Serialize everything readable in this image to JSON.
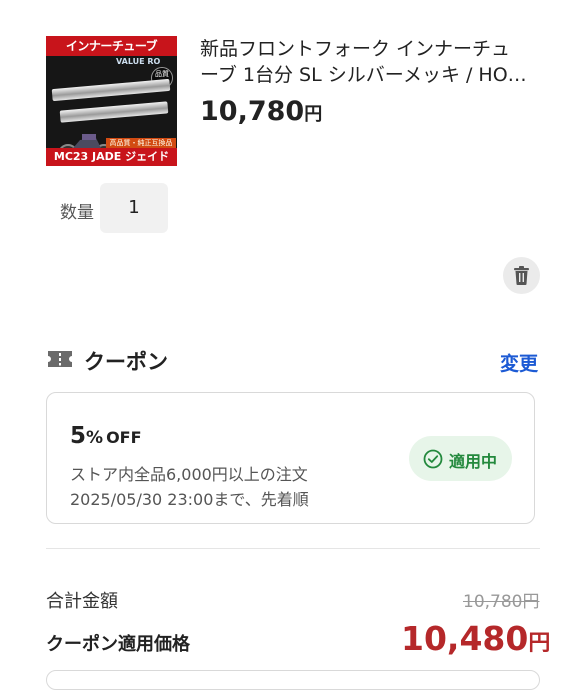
{
  "product": {
    "title_line1": "新品フロントフォーク インナーチュ",
    "title_line2": "ーブ 1台分 SL シルバーメッキ / HO…",
    "price_value": "10,780",
    "price_unit": "円",
    "image_banner_text": "インナーチューブ",
    "image_brand_text": "VALUE RO",
    "image_seal_text": "品質保証",
    "image_subtag_text": "高品質・純正互換品",
    "image_bottom_text": "MC23 JADE ジェイド"
  },
  "quantity": {
    "label": "数量",
    "value": "1"
  },
  "actions": {
    "delete_icon": "trash-icon"
  },
  "coupon": {
    "section_title": "クーポン",
    "section_icon": "ticket-icon",
    "change_label": "変更",
    "discount_number": "5",
    "discount_percent": "%",
    "discount_off": "OFF",
    "condition": "ストア内全品6,000円以上の注文",
    "deadline": "2025/05/30 23:00まで、先着順",
    "status_label": "適用中",
    "status_icon": "check-circle-icon",
    "status_color": "#23893d"
  },
  "summary": {
    "total_label": "合計金額",
    "total_original": "10,780円",
    "coupon_price_label": "クーポン適用価格",
    "coupon_price_value": "10,480",
    "coupon_price_unit": "円",
    "accent_color": "#b5282a",
    "link_color": "#1c5ad4"
  }
}
